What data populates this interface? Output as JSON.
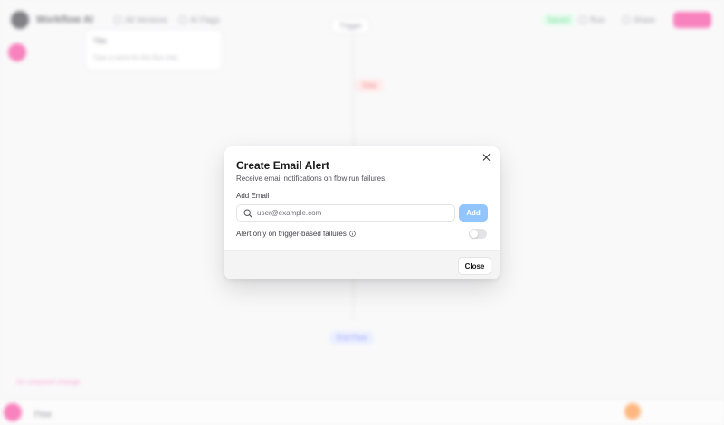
{
  "background": {
    "app_name": "Workflow AI",
    "toolbar_items": [
      "All Versions",
      "AI Flags"
    ],
    "status": "Saved",
    "run_label": "Run",
    "share_label": "Share",
    "dropdown_title": "Title",
    "dropdown_hint": "Type a name for this flow step",
    "trigger_node": "Trigger",
    "step_node": "Step",
    "end_node": "End Flow",
    "footer_pink_text": "An unsaved change",
    "footer_left_label": "Flow"
  },
  "modal": {
    "title": "Create Email Alert",
    "description": "Receive email notifications on flow run failures.",
    "field_label": "Add Email",
    "email_placeholder": "user@example.com",
    "email_value": "",
    "add_label": "Add",
    "toggle_label": "Alert only on trigger-based failures",
    "toggle_on": false,
    "close_label": "Close"
  },
  "colors": {
    "accent_pink": "#f43f9a",
    "add_button": "#93c5fd",
    "status_green": "#22c55e"
  },
  "icons": [
    "close-icon",
    "search-icon",
    "info-icon"
  ]
}
